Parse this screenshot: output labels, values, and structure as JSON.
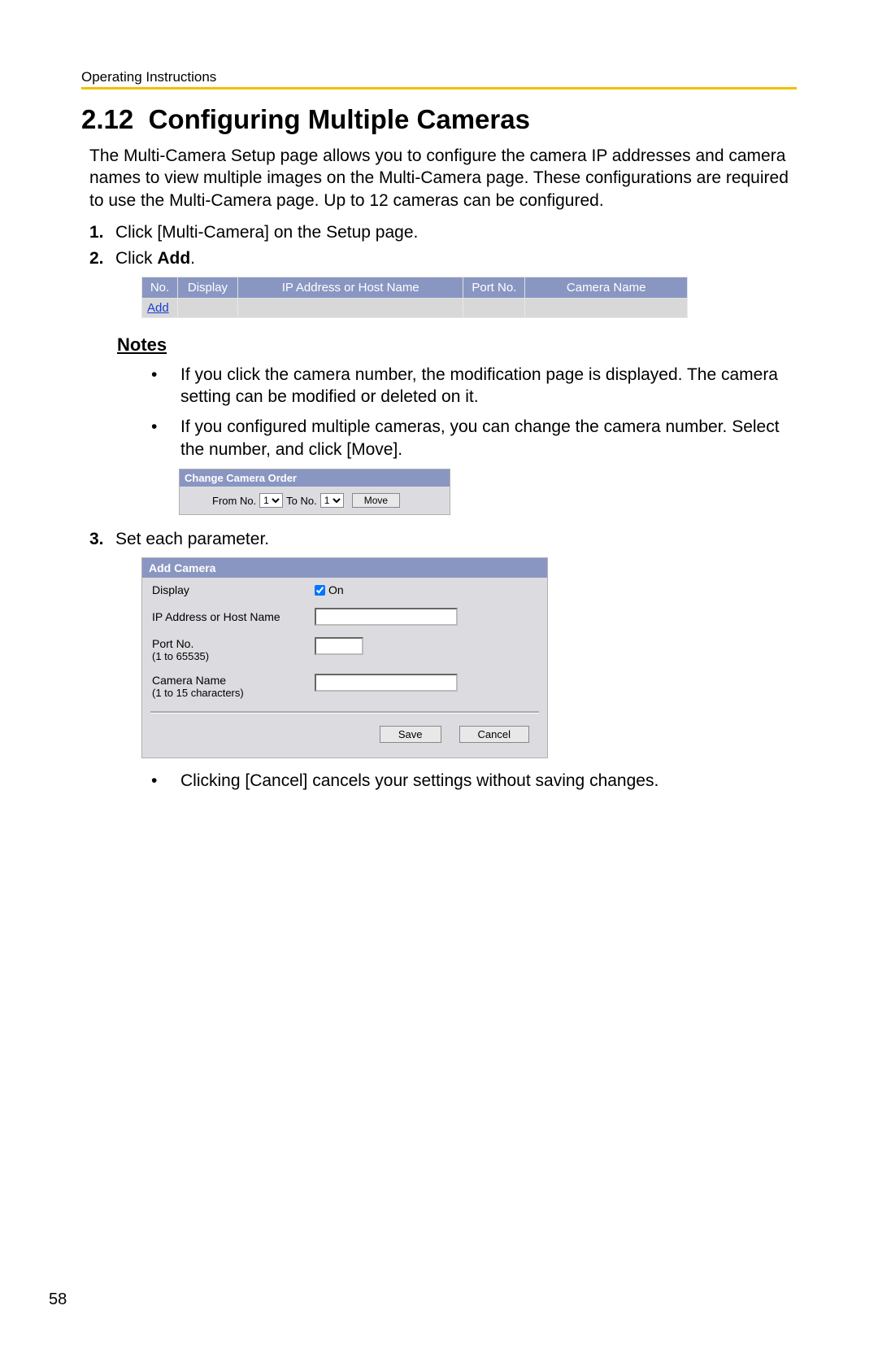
{
  "header": {
    "doc_title": "Operating Instructions"
  },
  "section": {
    "number": "2.12",
    "title": "Configuring Multiple Cameras",
    "intro": "The Multi-Camera Setup page allows you to configure the camera IP addresses and camera names to view multiple images on the Multi-Camera page. These configurations are required to use the Multi-Camera page. Up to 12 cameras can be configured."
  },
  "steps": {
    "s1_num": "1.",
    "s1_text": "Click [Multi-Camera] on the Setup page.",
    "s2_num": "2.",
    "s2_prefix": "Click ",
    "s2_bold": "Add",
    "s2_suffix": ".",
    "s3_num": "3.",
    "s3_text": "Set each parameter."
  },
  "camera_table": {
    "headers": {
      "no": "No.",
      "display": "Display",
      "ip": "IP Address or Host Name",
      "port": "Port No.",
      "name": "Camera Name"
    },
    "add_link": "Add"
  },
  "notes": {
    "heading": "Notes",
    "n1": "If you click the camera number, the modification page is displayed. The camera setting can be modified or deleted on it.",
    "n2": "If you configured multiple cameras, you can change the camera number. Select the number, and click [Move]."
  },
  "order_panel": {
    "title": "Change Camera Order",
    "from_label": "From No.",
    "to_label": "To No.",
    "from_value": "1",
    "to_value": "1",
    "move_btn": "Move"
  },
  "add_panel": {
    "title": "Add Camera",
    "display_label": "Display",
    "on_label": "On",
    "ip_label": "IP Address or Host Name",
    "port_label": "Port No.",
    "port_hint": "(1 to 65535)",
    "name_label": "Camera Name",
    "name_hint": "(1 to 15 characters)",
    "save_btn": "Save",
    "cancel_btn": "Cancel"
  },
  "post_note": "Clicking [Cancel] cancels your settings without saving changes.",
  "page_number": "58"
}
